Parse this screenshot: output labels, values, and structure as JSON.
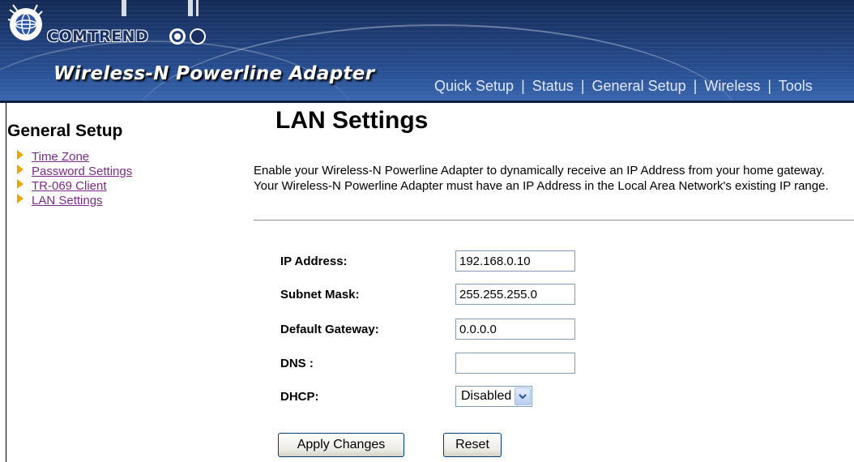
{
  "header": {
    "brand": "COMTREND",
    "product": "Wireless-N Powerline Adapter",
    "nav": [
      "Quick Setup",
      "Status",
      "General Setup",
      "Wireless",
      "Tools"
    ],
    "nav_separator": "|"
  },
  "sidebar": {
    "title": "General Setup",
    "items": [
      {
        "label": "Time Zone"
      },
      {
        "label": "Password Settings"
      },
      {
        "label": "TR-069 Client"
      },
      {
        "label": "LAN Settings"
      }
    ]
  },
  "main": {
    "title": "LAN Settings",
    "description": "Enable your Wireless-N Powerline Adapter to dynamically receive an IP Address from your home gateway. Your Wireless-N Powerline Adapter must have an IP Address in the Local Area Network's existing IP range.",
    "form": {
      "ip_label": "IP Address:",
      "ip_value": "192.168.0.10",
      "mask_label": "Subnet Mask:",
      "mask_value": "255.255.255.0",
      "gateway_label": "Default Gateway:",
      "gateway_value": "0.0.0.0",
      "dns_label": "DNS :",
      "dns_value": "",
      "dhcp_label": "DHCP:",
      "dhcp_value": "Disabled"
    },
    "buttons": {
      "apply": "Apply Changes",
      "reset": "Reset"
    }
  },
  "colors": {
    "header_bg": "#1f3e78",
    "link": "#7b2a8a",
    "arrow": "#e8a800"
  }
}
